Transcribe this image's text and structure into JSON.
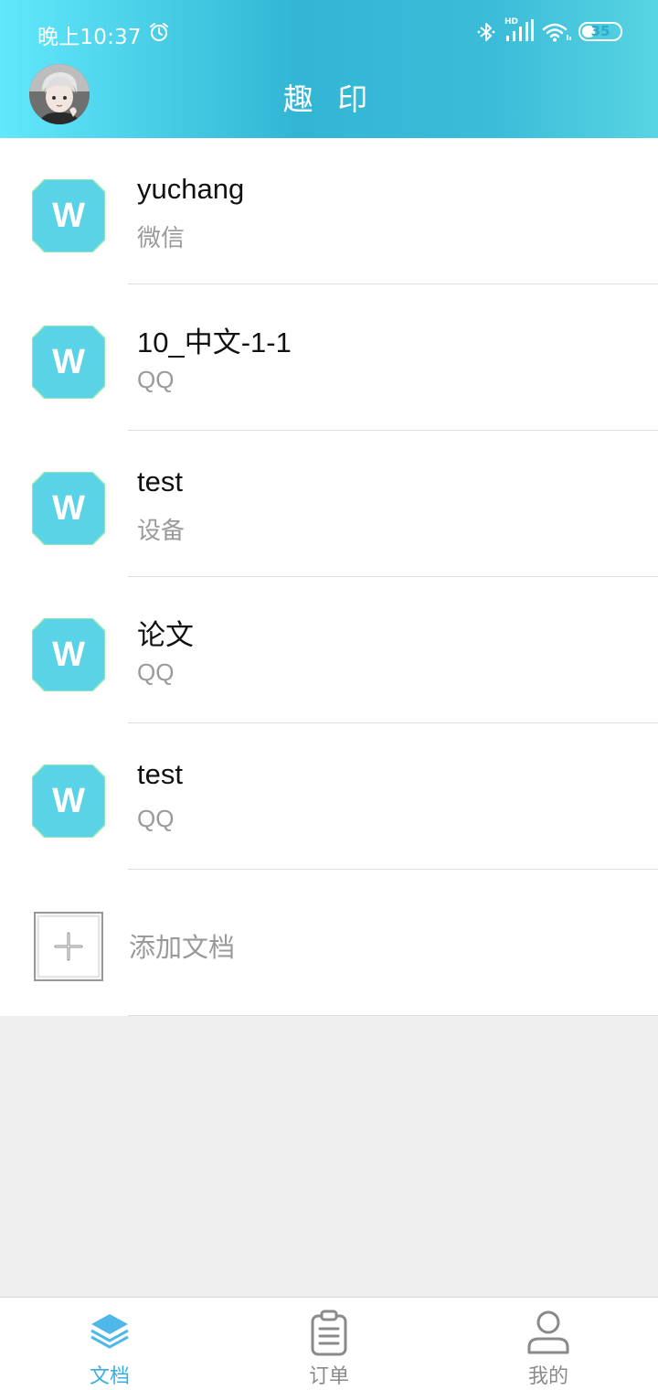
{
  "status_bar": {
    "time": "晚上10:37",
    "hd_label": "HD",
    "battery": "35",
    "battery_level": 0.35
  },
  "header": {
    "title": "趣 印",
    "avatar_icon": "user-avatar-photo"
  },
  "documents": [
    {
      "name": "yuchang",
      "source": "微信",
      "icon": "W"
    },
    {
      "name": "10_中文-1-1",
      "source": "QQ",
      "icon": "W"
    },
    {
      "name": "test",
      "source": "设备",
      "icon": "W"
    },
    {
      "name": "论文",
      "source": "QQ",
      "icon": "W"
    },
    {
      "name": "test",
      "source": "QQ",
      "icon": "W"
    }
  ],
  "add_document": {
    "label": "添加文档",
    "icon": "plus-icon"
  },
  "tabs": [
    {
      "label": "文档",
      "icon": "layers-icon",
      "active": true
    },
    {
      "label": "订单",
      "icon": "clipboard-icon",
      "active": false
    },
    {
      "label": "我的",
      "icon": "person-icon",
      "active": false
    }
  ],
  "colors": {
    "accent": "#3aaee0",
    "header_gradient": [
      "#62e8fb",
      "#32b6d4",
      "#58d4e2"
    ],
    "doc_icon": "#5ad3e6"
  }
}
